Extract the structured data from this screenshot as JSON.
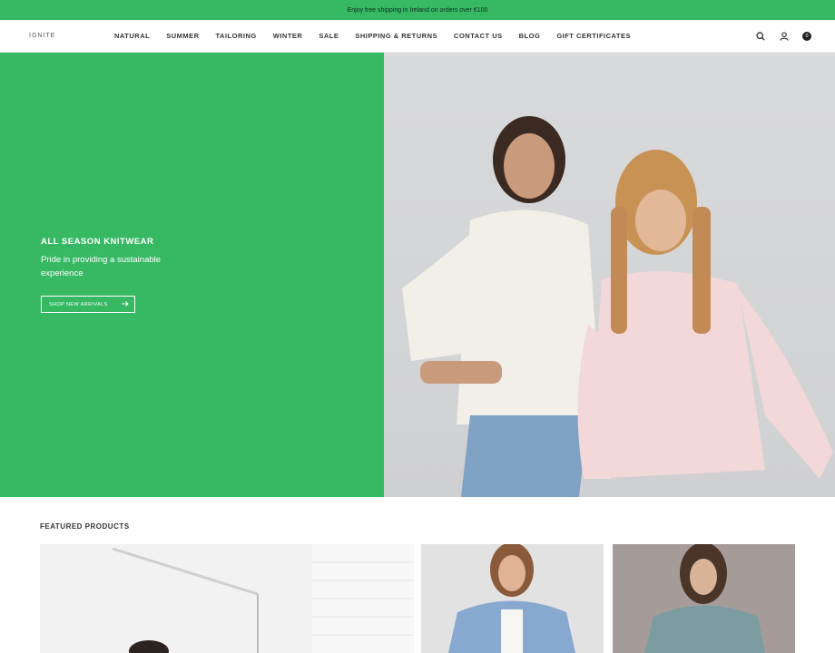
{
  "announcement": "Enjoy free shipping in Ireland on orders over €100",
  "header": {
    "logo": "IGNITE",
    "nav": [
      "NATURAL",
      "SUMMER",
      "TAILORING",
      "WINTER",
      "SALE",
      "SHIPPING & RETURNS",
      "CONTACT US",
      "BLOG",
      "GIFT CERTIFICATES"
    ],
    "cart_count": "0",
    "icons": [
      "search-icon",
      "account-icon",
      "cart-icon"
    ]
  },
  "hero": {
    "title": "ALL SEASON KNITWEAR",
    "subtitle": "Pride in providing a sustainable experience",
    "button_label": "SHOP NEW ARRIVALS",
    "accent_color": "#37b963"
  },
  "featured": {
    "title": "FEATURED PRODUCTS"
  }
}
